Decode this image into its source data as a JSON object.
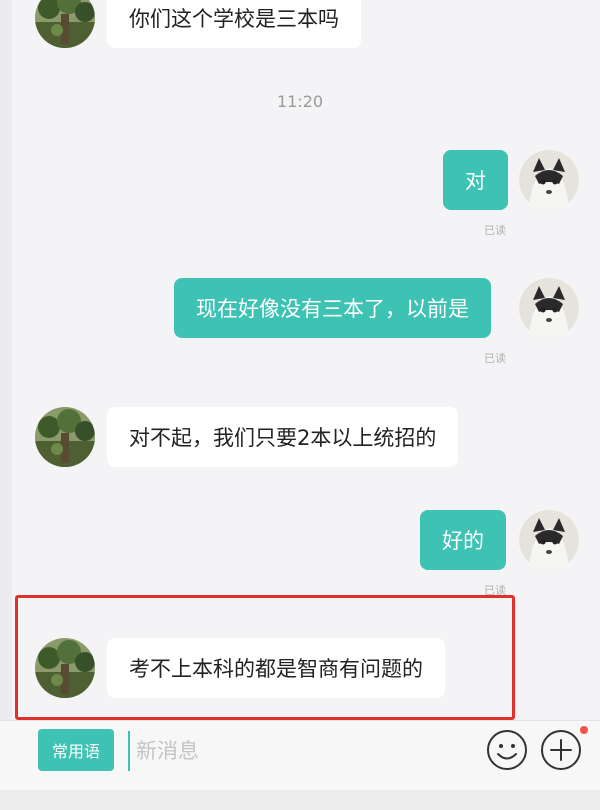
{
  "messages": [
    {
      "side": "in",
      "text": "你们这个学校是三本吗"
    },
    {
      "side": "out",
      "text": "对",
      "status": "已读"
    },
    {
      "side": "out",
      "text": "现在好像没有三本了，以前是",
      "status": "已读"
    },
    {
      "side": "in",
      "text": "对不起，我们只要2本以上统招的"
    },
    {
      "side": "out",
      "text": "好的",
      "status": "已读"
    },
    {
      "side": "in",
      "text": "考不上本科的都是智商有问题的"
    }
  ],
  "timestamp": "11:20",
  "input_bar": {
    "common_phrases_label": "常用语",
    "message_placeholder": "新消息",
    "emoji_icon": "smiley-face-icon",
    "add_icon": "plus-circle-icon"
  },
  "colors": {
    "accent": "#3dc2b4",
    "highlight_border": "#e0312d",
    "notification_dot": "#f2524a"
  }
}
